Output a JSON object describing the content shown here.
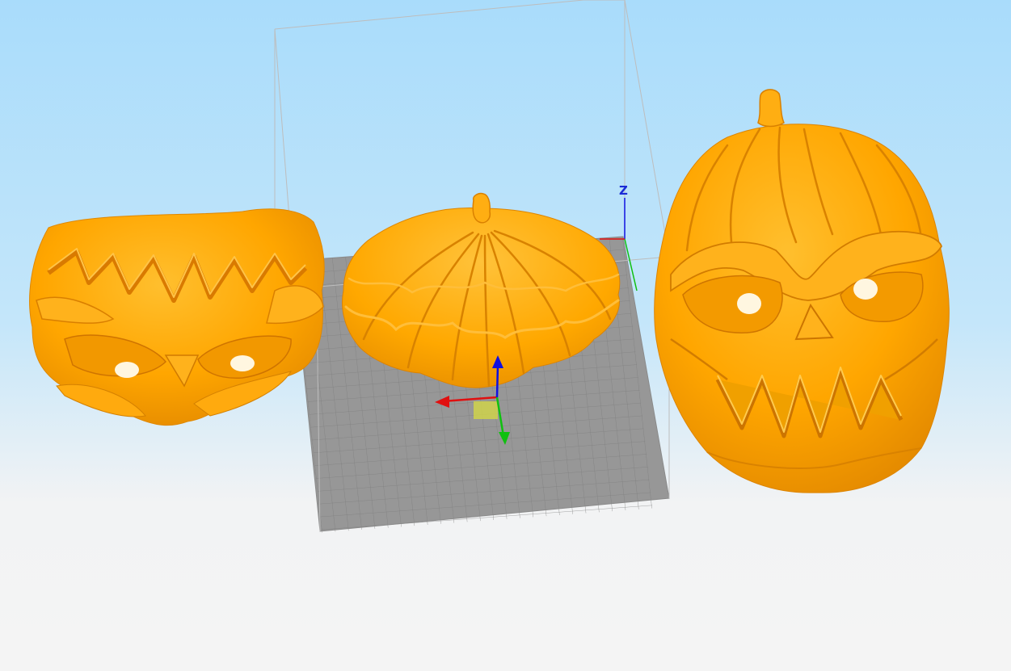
{
  "viewport": {
    "background_top": "#a9dcfb",
    "background_bottom": "#f4f4f4",
    "plate_color": "#979797",
    "grid_color": "#7d7d7d",
    "build_volume_color": "#bcbcbc",
    "model_color": "#ffa800",
    "model_shadow": "#d97f00",
    "model_highlight": "#ffc63a"
  },
  "axes": {
    "vertical_label": "Z",
    "x_color": "#e01010",
    "y_color": "#10c010",
    "z_color": "#1010e0"
  },
  "models": [
    {
      "name": "pumpkin-mask-upside-down"
    },
    {
      "name": "pumpkin-top-cap"
    },
    {
      "name": "pumpkin-face-mask"
    }
  ]
}
